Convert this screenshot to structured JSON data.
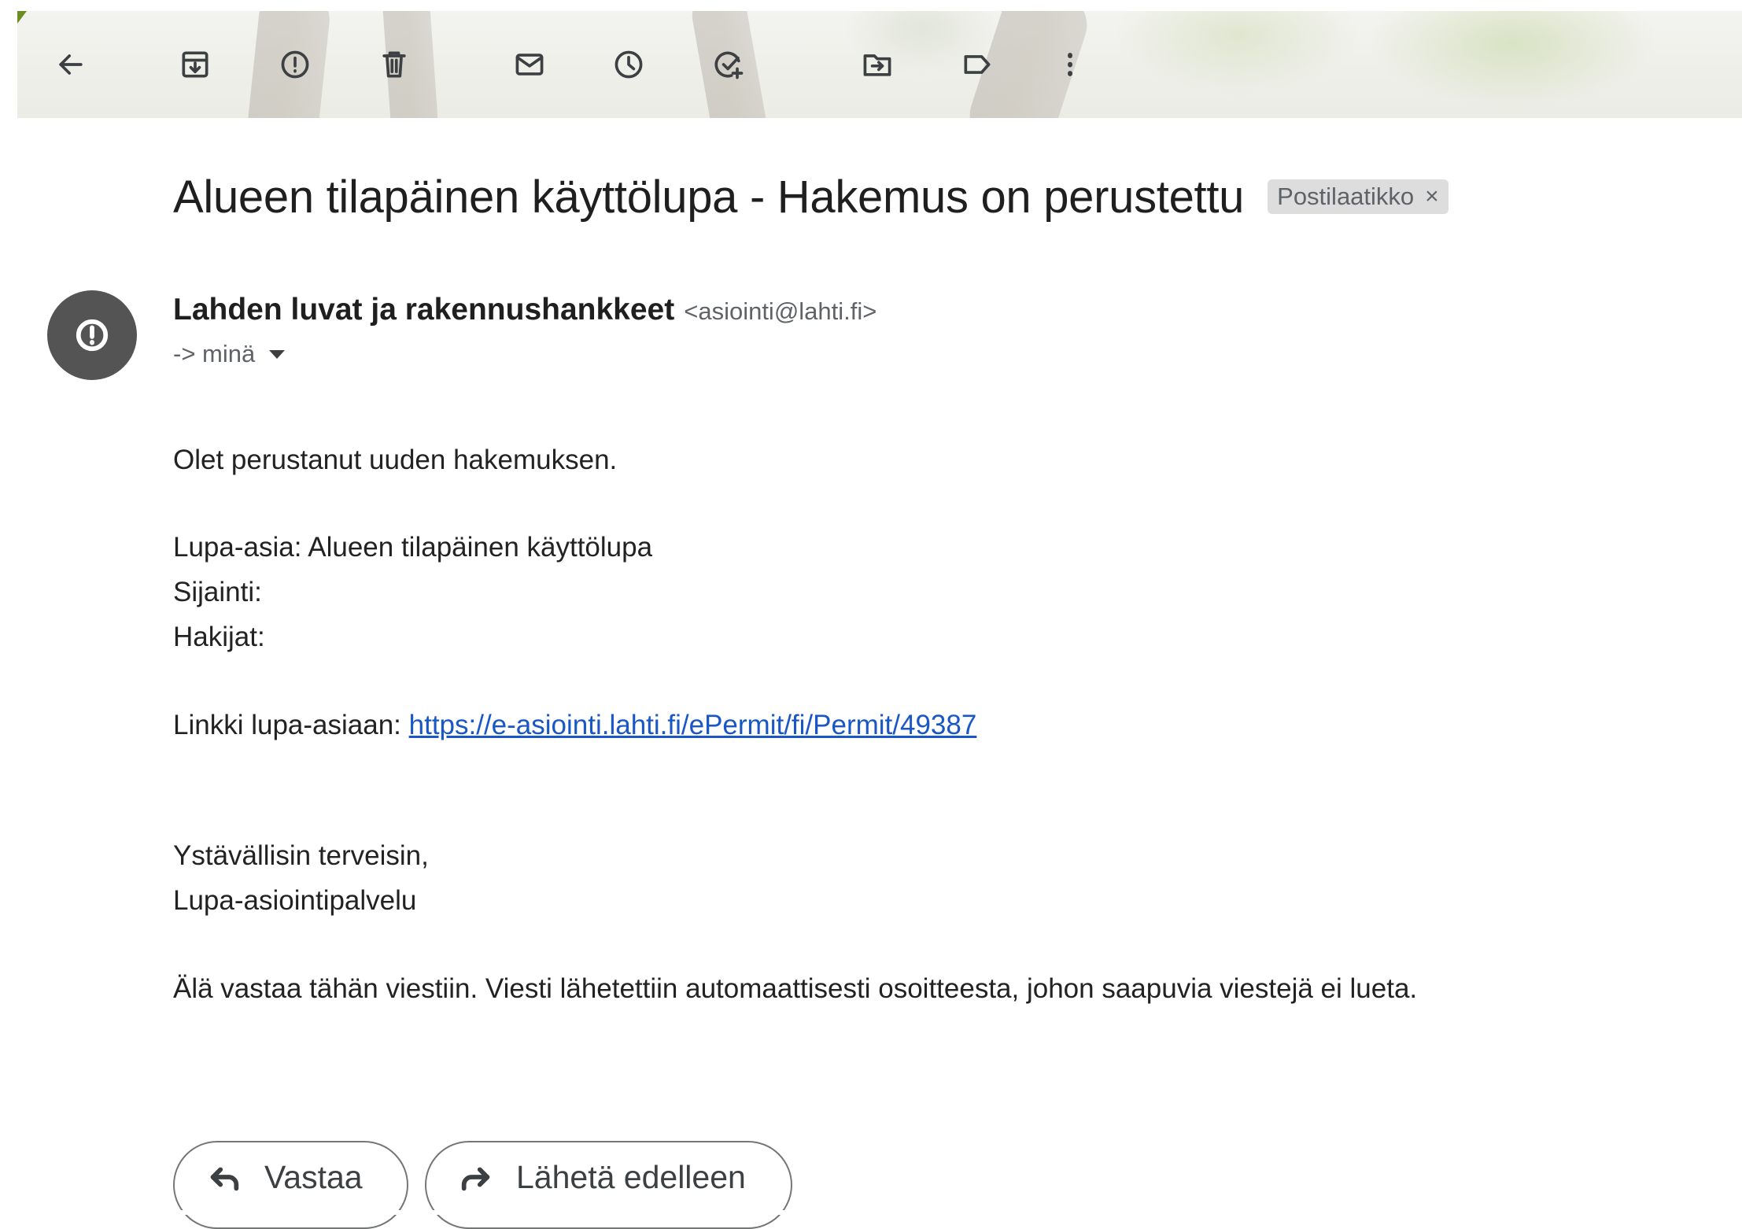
{
  "toolbar": {
    "icons": [
      "back-arrow-icon",
      "archive-icon",
      "report-spam-icon",
      "delete-icon",
      "mark-unread-icon",
      "snooze-icon",
      "add-to-tasks-icon",
      "move-to-icon",
      "label-icon",
      "more-options-icon"
    ]
  },
  "email": {
    "subject": "Alueen tilapäinen käyttölupa - Hakemus on perustettu",
    "label_chip": "Postilaatikko",
    "label_chip_close": "×",
    "sender_name": "Lahden luvat ja rakennushankkeet",
    "sender_email": "<asiointi@lahti.fi>",
    "recipient": "-> minä",
    "body": {
      "intro": "Olet perustanut uuden hakemuksen.",
      "lupa_asia": "Lupa-asia: Alueen tilapäinen käyttölupa",
      "sijainti": "Sijainti:",
      "hakijat": "Hakijat:",
      "link_prefix": "Linkki lupa-asiaan: ",
      "link_url": "https://e-asiointi.lahti.fi/ePermit/fi/Permit/49387",
      "greeting": "Ystävällisin terveisin,",
      "signature": "Lupa-asiointipalvelu",
      "notice": "Älä vastaa tähän viestiin. Viesti lähetettiin automaattisesti osoitteesta, johon saapuvia viestejä ei lueta."
    }
  },
  "actions": {
    "reply_label": "Vastaa",
    "forward_label": "Lähetä edelleen"
  },
  "colors": {
    "link": "#1a57c6",
    "avatar_bg": "#545454",
    "chip_bg": "#dddddd"
  }
}
